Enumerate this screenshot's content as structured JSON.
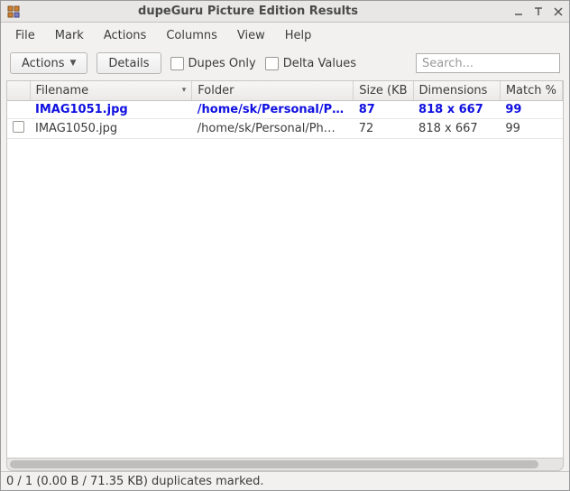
{
  "window": {
    "title": "dupeGuru Picture Edition Results"
  },
  "menus": {
    "file": "File",
    "mark": "Mark",
    "actions": "Actions",
    "columns": "Columns",
    "view": "View",
    "help": "Help"
  },
  "toolbar": {
    "actions_label": "Actions",
    "details_label": "Details",
    "dupes_only_label": "Dupes Only",
    "delta_values_label": "Delta Values",
    "search_placeholder": "Search..."
  },
  "columns": {
    "checkbox": "",
    "filename": "Filename",
    "folder": "Folder",
    "size": "Size (KB",
    "dimensions": "Dimensions",
    "match": "Match %"
  },
  "rows": [
    {
      "type": "ref",
      "filename": "IMAG1051.jpg",
      "folder": "/home/sk/Personal/P…",
      "size": "87",
      "dimensions": "818 x 667",
      "match": "99"
    },
    {
      "type": "dup",
      "filename": "IMAG1050.jpg",
      "folder": "/home/sk/Personal/Ph…",
      "size": "72",
      "dimensions": "818 x 667",
      "match": "99"
    }
  ],
  "status": {
    "text": "0 / 1 (0.00 B / 71.35 KB) duplicates marked."
  }
}
